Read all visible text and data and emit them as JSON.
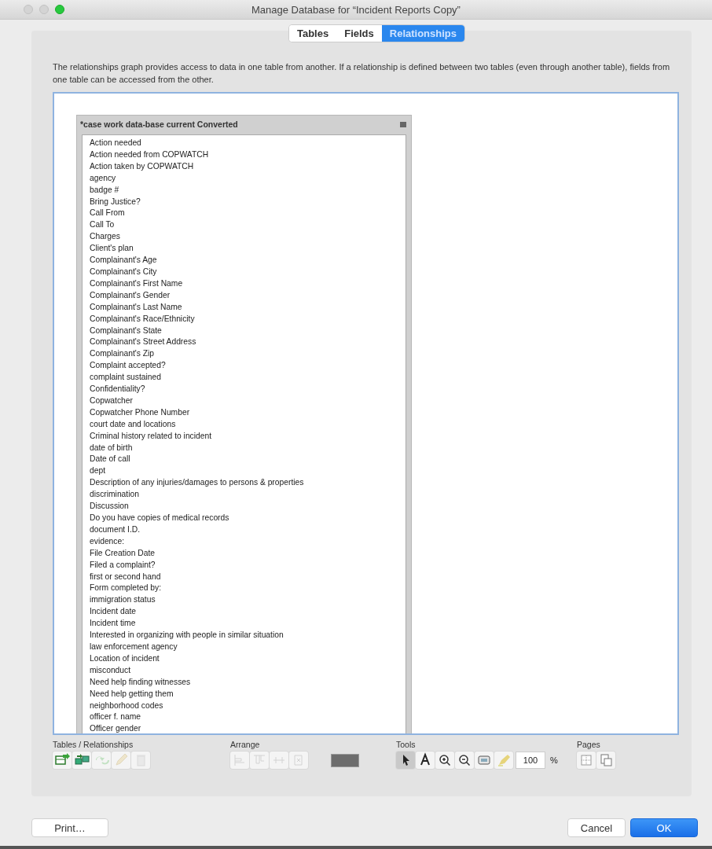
{
  "window": {
    "title": "Manage Database for “Incident Reports Copy”"
  },
  "tabs": [
    {
      "label": "Tables",
      "selected": false
    },
    {
      "label": "Fields",
      "selected": false
    },
    {
      "label": "Relationships",
      "selected": true
    }
  ],
  "description": "The relationships graph provides access to data in one table from another. If a relationship is defined between two tables (even through another table), fields from one table can be accessed from the other.",
  "graph_table": {
    "title": "*case work data-base current Converted",
    "fields": [
      "Action needed",
      "Action needed from COPWATCH",
      "Action taken by COPWATCH",
      "agency",
      "badge #",
      "Bring Justice?",
      "Call From",
      "Call To",
      "Charges",
      "Client's plan",
      "Complainant's Age",
      "Complainant's City",
      "Complainant's First Name",
      "Complainant's Gender",
      "Complainant's Last Name",
      "Complainant's Race/Ethnicity",
      "Complainant's State",
      "Complainant's Street Address",
      "Complainant's Zip",
      "Complaint accepted?",
      "complaint sustained",
      "Confidentiality?",
      "Copwatcher",
      "Copwatcher Phone Number",
      "court date and locations",
      "Criminal history related to incident",
      "date of birth",
      "Date of call",
      "dept",
      "Description of any injuries/damages to persons & properties",
      "discrimination",
      "Discussion",
      "Do you have copies of medical records",
      "document I.D.",
      "evidence:",
      "File Creation Date",
      "Filed a complaint?",
      "first or second hand",
      "Form completed by:",
      "immigration status",
      "Incident date",
      "Incident time",
      "Interested in organizing with people in similar situation",
      "law enforcement agency",
      "Location of incident",
      "misconduct",
      "Need help finding witnesses",
      "Need help getting them",
      "neighborhood codes",
      "officer f. name",
      "Officer gender"
    ]
  },
  "toolbar": [
    {
      "label": "Tables / Relationships",
      "tools": [
        {
          "kind": "add-table",
          "disabled": false,
          "selected": false
        },
        {
          "kind": "add-relationship",
          "disabled": false,
          "selected": false
        },
        {
          "kind": "duplicate",
          "disabled": true,
          "selected": false
        },
        {
          "kind": "edit",
          "disabled": true,
          "selected": false
        },
        {
          "kind": "delete",
          "disabled": true,
          "selected": false
        }
      ]
    },
    {
      "label": "Arrange",
      "tools": [
        {
          "kind": "align-left",
          "disabled": true,
          "selected": false
        },
        {
          "kind": "align-top",
          "disabled": true,
          "selected": false
        },
        {
          "kind": "distribute",
          "disabled": true,
          "selected": false
        },
        {
          "kind": "resize",
          "disabled": true,
          "selected": false
        },
        {
          "kind": "color",
          "disabled": false,
          "selected": false
        }
      ]
    },
    {
      "label": "Tools",
      "tools": [
        {
          "kind": "pointer",
          "disabled": false,
          "selected": true
        },
        {
          "kind": "text",
          "disabled": false,
          "selected": false
        },
        {
          "kind": "zoom-in",
          "disabled": false,
          "selected": false
        },
        {
          "kind": "zoom-out",
          "disabled": false,
          "selected": false
        },
        {
          "kind": "fit",
          "disabled": false,
          "selected": false
        },
        {
          "kind": "highlight",
          "disabled": false,
          "selected": false
        }
      ],
      "zoom_value": "100",
      "zoom_unit": "%"
    },
    {
      "label": "Pages",
      "tools": [
        {
          "kind": "page-grid",
          "disabled": false,
          "selected": false
        },
        {
          "kind": "page-setup",
          "disabled": false,
          "selected": false
        }
      ]
    }
  ],
  "buttons": [
    {
      "label": "Print…",
      "kind": "secondary"
    },
    {
      "label": "Cancel",
      "kind": "secondary"
    },
    {
      "label": "OK",
      "kind": "default"
    }
  ]
}
